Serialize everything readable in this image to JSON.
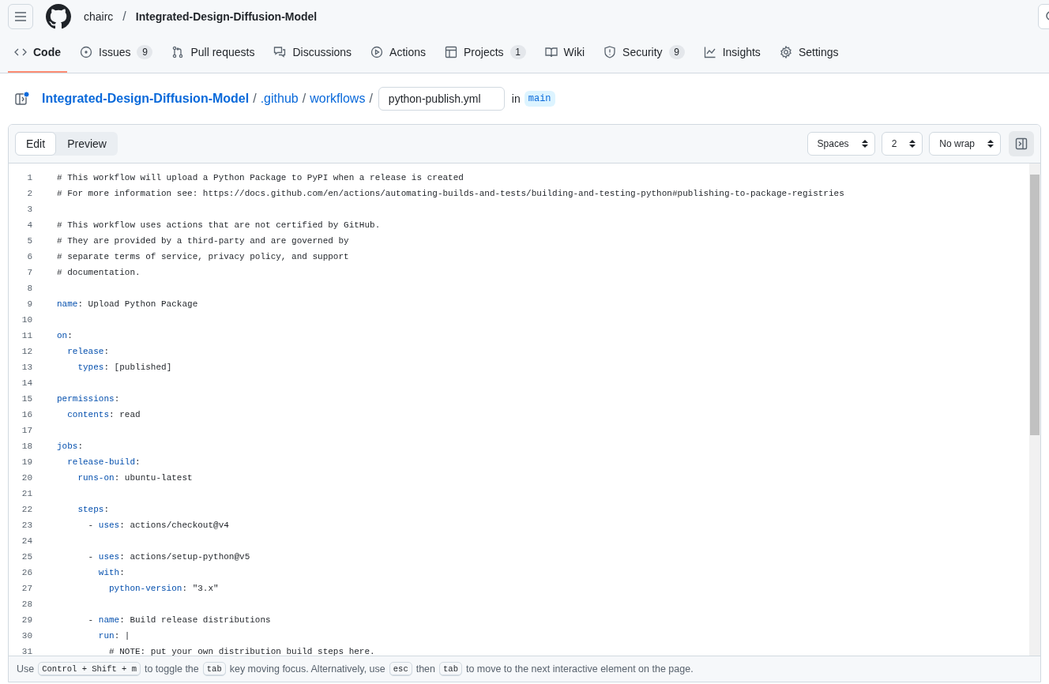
{
  "header": {
    "owner": "chairc",
    "separator": "/",
    "repo": "Integrated-Design-Diffusion-Model"
  },
  "tabs": [
    {
      "label": "Code",
      "selected": true
    },
    {
      "label": "Issues",
      "count": "9",
      "selected": false
    },
    {
      "label": "Pull requests",
      "selected": false
    },
    {
      "label": "Discussions",
      "selected": false
    },
    {
      "label": "Actions",
      "selected": false
    },
    {
      "label": "Projects",
      "count": "1",
      "selected": false
    },
    {
      "label": "Wiki",
      "selected": false
    },
    {
      "label": "Security",
      "count": "9",
      "selected": false
    },
    {
      "label": "Insights",
      "selected": false
    },
    {
      "label": "Settings",
      "selected": false
    }
  ],
  "breadcrumb": {
    "parts": [
      {
        "label": "Integrated-Design-Diffusion-Model",
        "kind": "repo"
      },
      {
        "label": "/",
        "kind": "sep"
      },
      {
        "label": ".github",
        "kind": "dir"
      },
      {
        "label": "/",
        "kind": "sep"
      },
      {
        "label": "workflows",
        "kind": "dir"
      },
      {
        "label": "/",
        "kind": "sep"
      }
    ],
    "filename": "python-publish.yml",
    "in_label": "in",
    "branch": "main"
  },
  "editor_tabs": [
    {
      "label": "Edit",
      "selected": true
    },
    {
      "label": "Preview",
      "selected": false
    }
  ],
  "selects": [
    "Spaces",
    "2",
    "No wrap"
  ],
  "code_lines": [
    {
      "number": "1",
      "parts": [
        {
          "kind": "comment",
          "text": "# This workflow will upload a Python Package to PyPI when a release is created"
        }
      ]
    },
    {
      "number": "2",
      "parts": [
        {
          "kind": "comment",
          "text": "# For more information see: https://docs.github.com/en/actions/automating-builds-and-tests/building-and-testing-python#publishing-to-package-registries"
        }
      ]
    },
    {
      "number": "3"
    },
    {
      "number": "4",
      "parts": [
        {
          "kind": "comment",
          "text": "# This workflow uses actions that are not certified by GitHub."
        }
      ]
    },
    {
      "number": "5",
      "parts": [
        {
          "kind": "comment",
          "text": "# They are provided by a third-party and are governed by"
        }
      ]
    },
    {
      "number": "6",
      "parts": [
        {
          "kind": "comment",
          "text": "# separate terms of service, privacy policy, and support"
        }
      ]
    },
    {
      "number": "7",
      "parts": [
        {
          "kind": "comment",
          "text": "# documentation."
        }
      ]
    },
    {
      "number": "8"
    },
    {
      "number": "9",
      "parts": [
        {
          "kind": "key",
          "text": "name"
        },
        {
          "kind": "plain",
          "text": ": Upload Python Package"
        }
      ]
    },
    {
      "number": "10"
    },
    {
      "number": "11",
      "parts": [
        {
          "kind": "key",
          "text": "on"
        },
        {
          "kind": "plain",
          "text": ":"
        }
      ]
    },
    {
      "number": "12",
      "parts": [
        {
          "kind": "key",
          "text": "  release"
        },
        {
          "kind": "plain",
          "text": ":"
        }
      ]
    },
    {
      "number": "13",
      "parts": [
        {
          "kind": "key",
          "text": "    types"
        },
        {
          "kind": "plain",
          "text": ": [published]"
        }
      ]
    },
    {
      "number": "14"
    },
    {
      "number": "15",
      "parts": [
        {
          "kind": "key",
          "text": "permissions"
        },
        {
          "kind": "plain",
          "text": ":"
        }
      ]
    },
    {
      "number": "16",
      "parts": [
        {
          "kind": "key",
          "text": "  contents"
        },
        {
          "kind": "plain",
          "text": ": read"
        }
      ]
    },
    {
      "number": "17"
    },
    {
      "number": "18",
      "parts": [
        {
          "kind": "key",
          "text": "jobs"
        },
        {
          "kind": "plain",
          "text": ":"
        }
      ]
    },
    {
      "number": "19",
      "parts": [
        {
          "kind": "key",
          "text": "  release-build"
        },
        {
          "kind": "plain",
          "text": ":"
        }
      ]
    },
    {
      "number": "20",
      "parts": [
        {
          "kind": "key",
          "text": "    runs-on"
        },
        {
          "kind": "plain",
          "text": ": ubuntu-latest"
        }
      ]
    },
    {
      "number": "21"
    },
    {
      "number": "22",
      "parts": [
        {
          "kind": "key",
          "text": "    steps"
        },
        {
          "kind": "plain",
          "text": ":"
        }
      ]
    },
    {
      "number": "23",
      "parts": [
        {
          "kind": "plain",
          "text": "      - "
        },
        {
          "kind": "key",
          "text": "uses"
        },
        {
          "kind": "plain",
          "text": ": actions/checkout@v4"
        }
      ]
    },
    {
      "number": "24"
    },
    {
      "number": "25",
      "parts": [
        {
          "kind": "plain",
          "text": "      - "
        },
        {
          "kind": "key",
          "text": "uses"
        },
        {
          "kind": "plain",
          "text": ": actions/setup-python@v5"
        }
      ]
    },
    {
      "number": "26",
      "parts": [
        {
          "kind": "key",
          "text": "        with"
        },
        {
          "kind": "plain",
          "text": ":"
        }
      ]
    },
    {
      "number": "27",
      "parts": [
        {
          "kind": "key",
          "text": "          python-version"
        },
        {
          "kind": "plain",
          "text": ": \"3.x\""
        }
      ]
    },
    {
      "number": "28"
    },
    {
      "number": "29",
      "parts": [
        {
          "kind": "plain",
          "text": "      - "
        },
        {
          "kind": "key",
          "text": "name"
        },
        {
          "kind": "plain",
          "text": ": Build release distributions"
        }
      ]
    },
    {
      "number": "30",
      "parts": [
        {
          "kind": "key",
          "text": "        run"
        },
        {
          "kind": "plain",
          "text": ": |"
        }
      ]
    },
    {
      "number": "31",
      "parts": [
        {
          "kind": "comment",
          "text": "          # NOTE: put your own distribution build steps here."
        }
      ]
    }
  ],
  "footer": [
    {
      "kind": "text",
      "text": "Use"
    },
    {
      "kind": "key",
      "text": "Control + Shift + m"
    },
    {
      "kind": "text",
      "text": "to toggle the"
    },
    {
      "kind": "key",
      "text": "tab"
    },
    {
      "kind": "text",
      "text": "key moving focus. Alternatively, use"
    },
    {
      "kind": "key",
      "text": "esc"
    },
    {
      "kind": "text",
      "text": "then"
    },
    {
      "kind": "key",
      "text": "tab"
    },
    {
      "kind": "text",
      "text": "to move to the next interactive element on the page."
    }
  ]
}
